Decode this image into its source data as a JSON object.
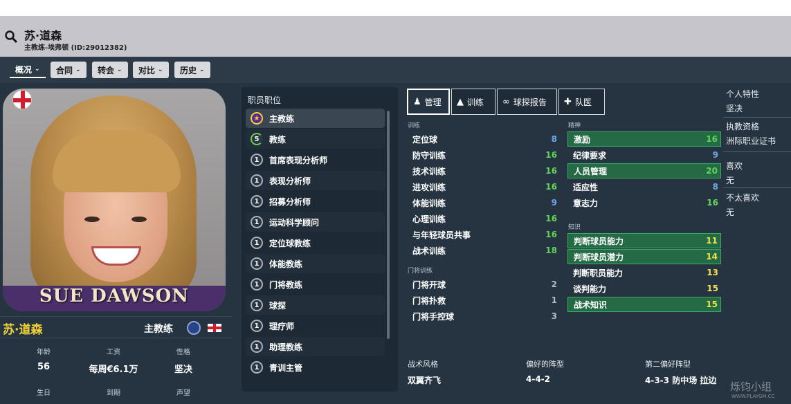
{
  "header": {
    "name": "苏·道森",
    "subtitle": "主教练-埃弗顿 (ID:29012382)"
  },
  "tabs": [
    {
      "label": "概况"
    },
    {
      "label": "合同"
    },
    {
      "label": "转会"
    },
    {
      "label": "对比"
    },
    {
      "label": "历史"
    }
  ],
  "profile": {
    "portrait_caption": "SUE DAWSON",
    "name": "苏·道森",
    "role": "主教练",
    "stats_row1": [
      {
        "key": "年龄",
        "value": "56"
      },
      {
        "key": "工资",
        "value": "每周€6.1万"
      },
      {
        "key": "性格",
        "value": "坚决"
      }
    ],
    "stats_row2": [
      {
        "key": "生日",
        "value": ""
      },
      {
        "key": "到期",
        "value": ""
      },
      {
        "key": "声望",
        "value": ""
      }
    ]
  },
  "staff_list": {
    "heading": "职员职位",
    "items": [
      {
        "badge": "★",
        "label": "主教练"
      },
      {
        "badge": "5",
        "label": "教练"
      },
      {
        "badge": "1",
        "label": "首席表现分析师"
      },
      {
        "badge": "1",
        "label": "表现分析师"
      },
      {
        "badge": "1",
        "label": "招募分析师"
      },
      {
        "badge": "1",
        "label": "运动科学顾问"
      },
      {
        "badge": "1",
        "label": "定位球教练"
      },
      {
        "badge": "1",
        "label": "体能教练"
      },
      {
        "badge": "1",
        "label": "门将教练"
      },
      {
        "badge": "1",
        "label": "球探"
      },
      {
        "badge": "1",
        "label": "理疗师"
      },
      {
        "badge": "1",
        "label": "助理教练"
      },
      {
        "badge": "1",
        "label": "青训主管"
      }
    ]
  },
  "right_tabs": [
    {
      "label": "管理"
    },
    {
      "label": "训练"
    },
    {
      "label": "球探报告"
    },
    {
      "label": "队医"
    }
  ],
  "attributes": {
    "training_title": "训练",
    "training": [
      {
        "name": "定位球",
        "value": "8"
      },
      {
        "name": "防守训练",
        "value": "16"
      },
      {
        "name": "技术训练",
        "value": "16"
      },
      {
        "name": "进攻训练",
        "value": "16"
      },
      {
        "name": "体能训练",
        "value": "9"
      },
      {
        "name": "心理训练",
        "value": "16"
      },
      {
        "name": "与年轻球员共事",
        "value": "16"
      },
      {
        "name": "战术训练",
        "value": "18"
      }
    ],
    "gk_title": "门将训练",
    "gk": [
      {
        "name": "门将开球",
        "value": "2"
      },
      {
        "name": "门将扑救",
        "value": "1"
      },
      {
        "name": "门将手控球",
        "value": "3"
      }
    ],
    "mental_title": "精神",
    "mental": [
      {
        "name": "激励",
        "value": "16"
      },
      {
        "name": "纪律要求",
        "value": "9"
      },
      {
        "name": "人员管理",
        "value": "20"
      },
      {
        "name": "适应性",
        "value": "8"
      },
      {
        "name": "意志力",
        "value": "16"
      }
    ],
    "knowledge_title": "知识",
    "knowledge": [
      {
        "name": "判断球员能力",
        "value": "11"
      },
      {
        "name": "判断球员潜力",
        "value": "14"
      },
      {
        "name": "判断职员能力",
        "value": "13"
      },
      {
        "name": "谈判能力",
        "value": "15"
      },
      {
        "name": "战术知识",
        "value": "15"
      }
    ]
  },
  "side_info": [
    {
      "key": "个人特性",
      "value": "坚决"
    },
    {
      "key": "执教资格",
      "value": "洲际职业证书"
    },
    {
      "key": "喜欢",
      "value": "无"
    },
    {
      "key": "不太喜欢",
      "value": "无"
    }
  ],
  "tactics": [
    {
      "key": "战术风格",
      "value": "双翼齐飞"
    },
    {
      "key": "偏好的阵型",
      "value": "4-4-2"
    },
    {
      "key": "第二偏好阵型",
      "value": "4-3-3 防中场 拉边"
    }
  ],
  "watermark": {
    "text": "烁钧小组",
    "url": "WWW.PLAYGM.CC"
  },
  "colors": {
    "highlight": "#246a45",
    "name_yellow": "#f3d23a",
    "val_green": "#5fd65a",
    "val_yellow": "#f1e14a",
    "val_blue": "#6fa6ec"
  }
}
